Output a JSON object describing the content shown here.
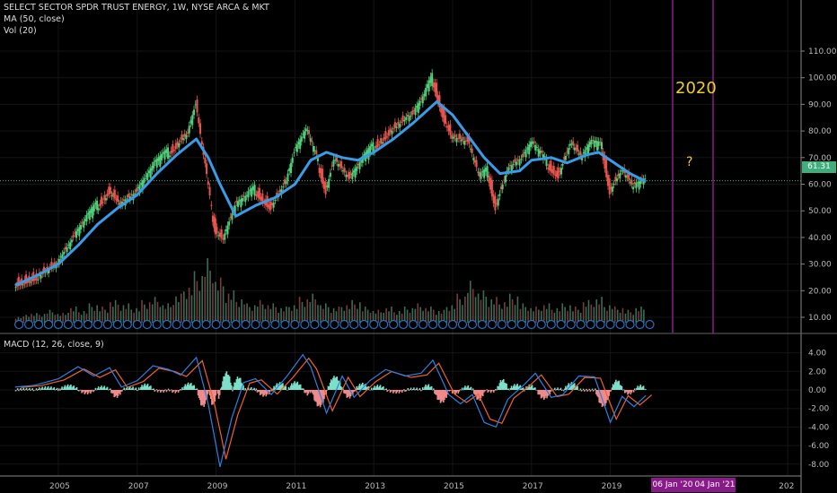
{
  "header": {
    "title": "SELECT SECTOR SPDR TRUST ENERGY, 1W, NYSE ARCA & MKT",
    "ma_label": "MA (50, close)",
    "vol_label": "Vol (20)",
    "macd_label": "MACD (12, 26, close, 9)"
  },
  "annotations": {
    "year_text": "2020",
    "question": "?",
    "date_badge_1": "06 Jan '20",
    "date_badge_2": "04 Jan '21"
  },
  "colors": {
    "up": "#4fd07a",
    "down": "#e8554e",
    "ma": "#3a9be8",
    "macd": "#2f7fe0",
    "signal": "#f0622f",
    "hist_up": "#7de0c8",
    "hist_down": "#f08a8a",
    "marker": "#8a1a8a",
    "price_label": "#3fae7a",
    "annotation": "#f0d020"
  },
  "chart_data": {
    "type": "line",
    "title": "SELECT SECTOR SPDR TRUST ENERGY, 1W, NYSE ARCA & MKT",
    "last_price": "61.31",
    "price_axis": {
      "ticks": [
        "110.00",
        "100.00",
        "90.00",
        "80.00",
        "70.00",
        "60.00",
        "50.00",
        "40.00",
        "30.00",
        "20.00",
        "10.00"
      ],
      "range": [
        10,
        110
      ]
    },
    "macd_axis": {
      "ticks": [
        "4.00",
        "2.00",
        "0.00",
        "-2.00",
        "-4.00",
        "-6.00",
        "-8.00"
      ],
      "range": [
        -8,
        4
      ]
    },
    "x_ticks": [
      "2005",
      "2007",
      "2009",
      "2011",
      "2013",
      "2015",
      "2017",
      "2019",
      "202"
    ],
    "x_tick_years": [
      2005,
      2007,
      2009,
      2011,
      2013,
      2015,
      2017,
      2019,
      2023.5
    ],
    "price": [
      [
        2003.9,
        23
      ],
      [
        2004.5,
        26
      ],
      [
        2005,
        31
      ],
      [
        2005.4,
        40
      ],
      [
        2005.7,
        46
      ],
      [
        2006,
        52
      ],
      [
        2006.3,
        58
      ],
      [
        2006.6,
        53
      ],
      [
        2007,
        57
      ],
      [
        2007.4,
        66
      ],
      [
        2007.8,
        72
      ],
      [
        2008,
        75
      ],
      [
        2008.3,
        80
      ],
      [
        2008.5,
        90
      ],
      [
        2008.7,
        70
      ],
      [
        2008.9,
        50
      ],
      [
        2009,
        43
      ],
      [
        2009.2,
        40
      ],
      [
        2009.5,
        52
      ],
      [
        2009.8,
        55
      ],
      [
        2010,
        58
      ],
      [
        2010.4,
        52
      ],
      [
        2010.8,
        62
      ],
      [
        2011,
        72
      ],
      [
        2011.3,
        80
      ],
      [
        2011.6,
        68
      ],
      [
        2011.8,
        58
      ],
      [
        2012,
        70
      ],
      [
        2012.4,
        62
      ],
      [
        2012.7,
        68
      ],
      [
        2013,
        74
      ],
      [
        2013.4,
        80
      ],
      [
        2013.8,
        85
      ],
      [
        2014,
        86
      ],
      [
        2014.3,
        93
      ],
      [
        2014.5,
        100
      ],
      [
        2014.8,
        85
      ],
      [
        2015,
        78
      ],
      [
        2015.4,
        76
      ],
      [
        2015.7,
        62
      ],
      [
        2015.9,
        65
      ],
      [
        2016.1,
        52
      ],
      [
        2016.4,
        66
      ],
      [
        2016.8,
        70
      ],
      [
        2017,
        75
      ],
      [
        2017.4,
        68
      ],
      [
        2017.7,
        64
      ],
      [
        2018,
        76
      ],
      [
        2018.3,
        70
      ],
      [
        2018.5,
        75
      ],
      [
        2018.8,
        74
      ],
      [
        2019,
        58
      ],
      [
        2019.3,
        66
      ],
      [
        2019.6,
        59
      ],
      [
        2019.9,
        61.31
      ]
    ],
    "ma50": [
      [
        2003.9,
        22
      ],
      [
        2004.5,
        26
      ],
      [
        2005,
        30
      ],
      [
        2005.5,
        37
      ],
      [
        2006,
        45
      ],
      [
        2006.5,
        51
      ],
      [
        2007,
        56
      ],
      [
        2007.5,
        64
      ],
      [
        2008,
        71
      ],
      [
        2008.5,
        77
      ],
      [
        2008.8,
        70
      ],
      [
        2009.1,
        60
      ],
      [
        2009.5,
        48
      ],
      [
        2010,
        52
      ],
      [
        2010.5,
        55
      ],
      [
        2011,
        60
      ],
      [
        2011.4,
        69
      ],
      [
        2011.8,
        72
      ],
      [
        2012.2,
        70
      ],
      [
        2012.6,
        69
      ],
      [
        2013,
        72
      ],
      [
        2013.5,
        77
      ],
      [
        2014,
        83
      ],
      [
        2014.6,
        91
      ],
      [
        2015,
        86
      ],
      [
        2015.4,
        78
      ],
      [
        2015.8,
        70
      ],
      [
        2016.2,
        64
      ],
      [
        2016.7,
        65
      ],
      [
        2017,
        69
      ],
      [
        2017.5,
        70
      ],
      [
        2017.9,
        68
      ],
      [
        2018.4,
        71
      ],
      [
        2018.7,
        72
      ],
      [
        2019,
        69
      ],
      [
        2019.5,
        64
      ],
      [
        2019.9,
        61
      ]
    ],
    "volume": [
      2,
      3,
      3,
      4,
      3,
      5,
      4,
      6,
      5,
      7,
      6,
      5,
      7,
      8,
      6,
      9,
      12,
      16,
      20,
      14,
      10,
      8,
      6,
      7,
      6,
      5,
      6,
      8,
      9,
      6,
      5,
      6,
      7,
      5,
      4,
      5,
      4,
      5,
      6,
      5,
      4,
      6,
      9,
      13,
      10,
      8,
      7,
      9,
      6,
      5,
      6,
      5,
      6,
      5,
      7,
      8,
      6,
      5,
      4,
      5
    ],
    "macd": [
      [
        2003.9,
        0.3
      ],
      [
        2004.4,
        0.5
      ],
      [
        2005,
        1.2
      ],
      [
        2005.5,
        2.5
      ],
      [
        2005.9,
        1.5
      ],
      [
        2006.3,
        2.4
      ],
      [
        2006.6,
        0.3
      ],
      [
        2007,
        1.0
      ],
      [
        2007.4,
        2.6
      ],
      [
        2007.8,
        2.2
      ],
      [
        2008.1,
        1.6
      ],
      [
        2008.5,
        3.5
      ],
      [
        2008.8,
        -1.5
      ],
      [
        2009,
        -6
      ],
      [
        2009.1,
        -8.3
      ],
      [
        2009.4,
        -3
      ],
      [
        2009.7,
        0.8
      ],
      [
        2010,
        1.2
      ],
      [
        2010.4,
        -0.5
      ],
      [
        2010.8,
        1.5
      ],
      [
        2011.2,
        3.8
      ],
      [
        2011.4,
        2.5
      ],
      [
        2011.8,
        -2.5
      ],
      [
        2012.2,
        1.5
      ],
      [
        2012.5,
        -0.8
      ],
      [
        2012.9,
        1.0
      ],
      [
        2013.3,
        2.2
      ],
      [
        2013.8,
        1.5
      ],
      [
        2014.2,
        1.8
      ],
      [
        2014.5,
        3.2
      ],
      [
        2014.9,
        -0.5
      ],
      [
        2015.2,
        -1.5
      ],
      [
        2015.5,
        -0.5
      ],
      [
        2015.8,
        -3.5
      ],
      [
        2016.1,
        -4
      ],
      [
        2016.4,
        -1
      ],
      [
        2016.8,
        0.5
      ],
      [
        2017.1,
        1.8
      ],
      [
        2017.5,
        -0.8
      ],
      [
        2017.8,
        -0.5
      ],
      [
        2018.2,
        1.5
      ],
      [
        2018.6,
        1.4
      ],
      [
        2019,
        -3.5
      ],
      [
        2019.3,
        -0.7
      ],
      [
        2019.6,
        -1.8
      ],
      [
        2019.9,
        -0.6
      ]
    ],
    "signal_shift": 0.15
  }
}
